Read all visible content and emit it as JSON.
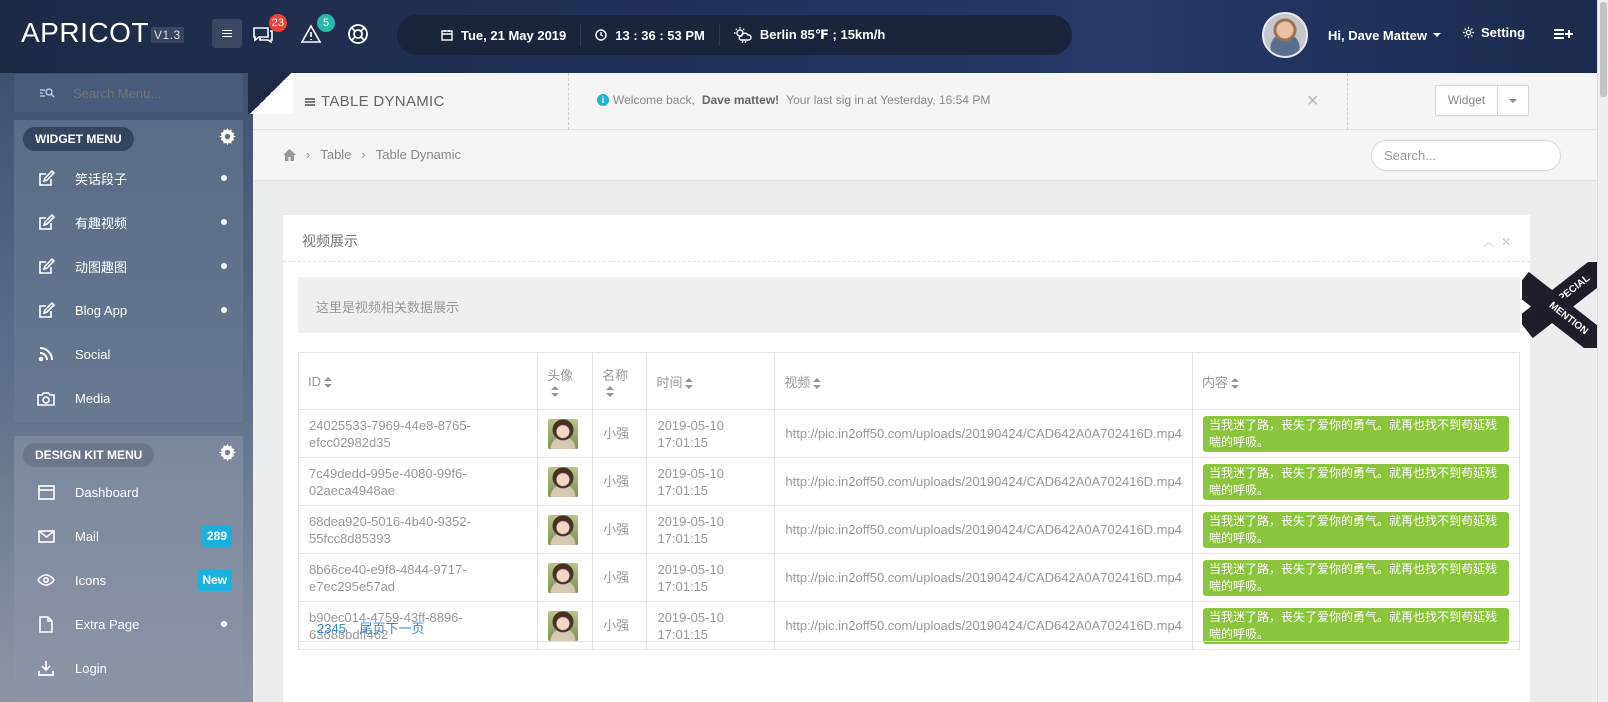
{
  "brand": {
    "name": "APRICOT",
    "version": "V1.3"
  },
  "topbar": {
    "notifications_count": "23",
    "alerts_count": "5",
    "date": "Tue, 21 May 2019",
    "time": "13 : 36 : 53 PM",
    "weather": "Berlin  85℉ ; 15km/h",
    "user_greeting": "Hi, Dave Mattew",
    "setting_label": "Setting",
    "colors": {
      "notif_badge": "#e8443a",
      "alert_badge": "#2bb7a5"
    }
  },
  "sidebar": {
    "search_placeholder": "Search Menu...",
    "widget_menu": {
      "title": "WIDGET MENU",
      "items": [
        {
          "label": "笑话段子",
          "icon": "edit-icon",
          "marker": "dot"
        },
        {
          "label": "有趣视频",
          "icon": "edit-icon",
          "marker": "dot"
        },
        {
          "label": "动图趣图",
          "icon": "edit-icon",
          "marker": "dot"
        },
        {
          "label": "Blog App",
          "icon": "edit-icon",
          "marker": "dot"
        },
        {
          "label": "Social",
          "icon": "rss-icon",
          "marker": ""
        },
        {
          "label": "Media",
          "icon": "camera-icon",
          "marker": ""
        }
      ]
    },
    "design_menu": {
      "title": "DESIGN KIT MENU",
      "items": [
        {
          "label": "Dashboard",
          "icon": "window-icon",
          "badge": ""
        },
        {
          "label": "Mail",
          "icon": "mail-icon",
          "badge": "289"
        },
        {
          "label": "Icons",
          "icon": "eye-icon",
          "badge": "New"
        },
        {
          "label": "Extra Page",
          "icon": "file-icon",
          "badge": ""
        },
        {
          "label": "Login",
          "icon": "download-icon",
          "badge": ""
        }
      ]
    }
  },
  "page": {
    "title": "TABLE DYNAMIC",
    "welcome_prefix": "Welcome back,",
    "welcome_name": "Dave mattew!",
    "welcome_suffix": "Your last sig in at Yesterday, 16:54 PM",
    "widget_button": "Widget",
    "breadcrumbs": [
      "Table",
      "Table Dynamic"
    ],
    "search_placeholder": "Search..."
  },
  "card": {
    "title": "视频展示",
    "notice": "这里是视频相关数据展示",
    "columns": [
      "ID",
      "头像",
      "名称",
      "时间",
      "视频",
      "内容"
    ],
    "rows": [
      {
        "id": "24025533-7969-44e8-8765-efcc02982d35",
        "name": "小强",
        "time": "2019-05-10 17:01:15",
        "video": "http://pic.in2off50.com/uploads/20190424/CAD642A0A702416D.mp4",
        "content": "当我迷了路，丧失了爱你的勇气。就再也找不到苟延残喘的呼吸。"
      },
      {
        "id": "7c49dedd-995e-4080-99f6-02aeca4948ae",
        "name": "小强",
        "time": "2019-05-10 17:01:15",
        "video": "http://pic.in2off50.com/uploads/20190424/CAD642A0A702416D.mp4",
        "content": "当我迷了路，丧失了爱你的勇气。就再也找不到苟延残喘的呼吸。"
      },
      {
        "id": "68dea920-5016-4b40-9352-55fcc8d85393",
        "name": "小强",
        "time": "2019-05-10 17:01:15",
        "video": "http://pic.in2off50.com/uploads/20190424/CAD642A0A702416D.mp4",
        "content": "当我迷了路，丧失了爱你的勇气。就再也找不到苟延残喘的呼吸。"
      },
      {
        "id": "8b66ce40-e9f8-4844-9717-e7ec295e57ad",
        "name": "小强",
        "time": "2019-05-10 17:01:15",
        "video": "http://pic.in2off50.com/uploads/20190424/CAD642A0A702416D.mp4",
        "content": "当我迷了路，丧失了爱你的勇气。就再也找不到苟延残喘的呼吸。"
      },
      {
        "id": "b90ec014-4759-43ff-8896-63688bdff462",
        "name": "小强",
        "time": "2019-05-10 17:01:15",
        "video": "http://pic.in2off50.com/uploads/20190424/CAD642A0A702416D.mp4",
        "content": "当我迷了路，丧失了爱你的勇气。就再也找不到苟延残喘的呼吸。"
      }
    ],
    "pagination": [
      "2345",
      "尾页下一页"
    ],
    "content_tag_color": "#8bc43d"
  },
  "ribbon": {
    "line1": "SPECIAL",
    "line2": "MENTION"
  }
}
